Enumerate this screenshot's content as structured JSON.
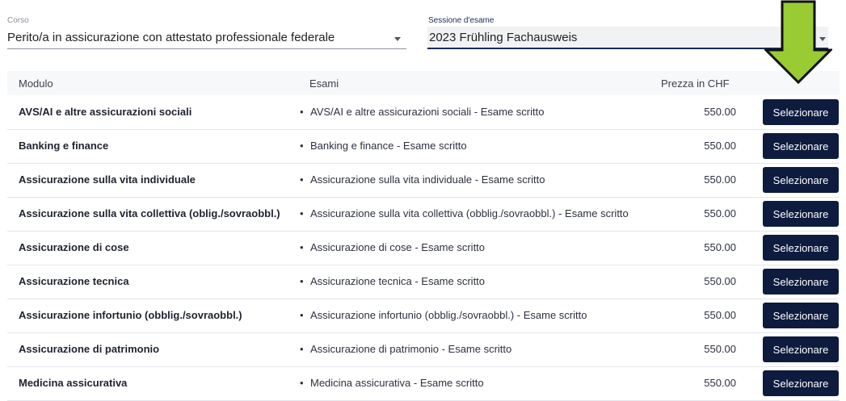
{
  "filters": {
    "corso": {
      "label": "Corso",
      "value": "Perito/a in assicurazione con attestato professionale federale"
    },
    "sessione": {
      "label": "Sessione d'esame",
      "value": "2023 Frühling Fachausweis"
    }
  },
  "table": {
    "headers": {
      "modulo": "Modulo",
      "esami": "Esami",
      "prezzo": "Prezza in CHF"
    },
    "button_label": "Selezionare",
    "bullet": "•",
    "rows": [
      {
        "modulo": "AVS/AI e altre assicurazioni sociali",
        "esame": "AVS/AI e altre assicurazioni sociali - Esame scritto",
        "prezzo": "550.00"
      },
      {
        "modulo": "Banking e finance",
        "esame": "Banking e finance - Esame scritto",
        "prezzo": "550.00"
      },
      {
        "modulo": "Assicurazione sulla vita individuale",
        "esame": "Assicurazione sulla vita individuale - Esame scritto",
        "prezzo": "550.00"
      },
      {
        "modulo": "Assicurazione sulla vita collettiva (oblig./sovraobbl.)",
        "esame": "Assicurazione sulla vita collettiva (obblig./sovraobbl.) - Esame scritto",
        "prezzo": "550.00"
      },
      {
        "modulo": "Assicurazione di cose",
        "esame": "Assicurazione di cose - Esame scritto",
        "prezzo": "550.00"
      },
      {
        "modulo": "Assicurazione tecnica",
        "esame": "Assicurazione tecnica - Esame scritto",
        "prezzo": "550.00"
      },
      {
        "modulo": "Assicurazione infortunio (obblig./sovraobbl.)",
        "esame": "Assicurazione infortunio (obblig./sovraobbl.) - Esame scritto",
        "prezzo": "550.00"
      },
      {
        "modulo": "Assicurazione di patrimonio",
        "esame": "Assicurazione di patrimonio - Esame scritto",
        "prezzo": "550.00"
      },
      {
        "modulo": "Medicina assicurativa",
        "esame": "Medicina assicurativa - Esame scritto",
        "prezzo": "550.00"
      }
    ]
  },
  "annotation": {
    "icon": "down-arrow-icon",
    "fill": "#99cc33",
    "stroke": "#111111"
  }
}
